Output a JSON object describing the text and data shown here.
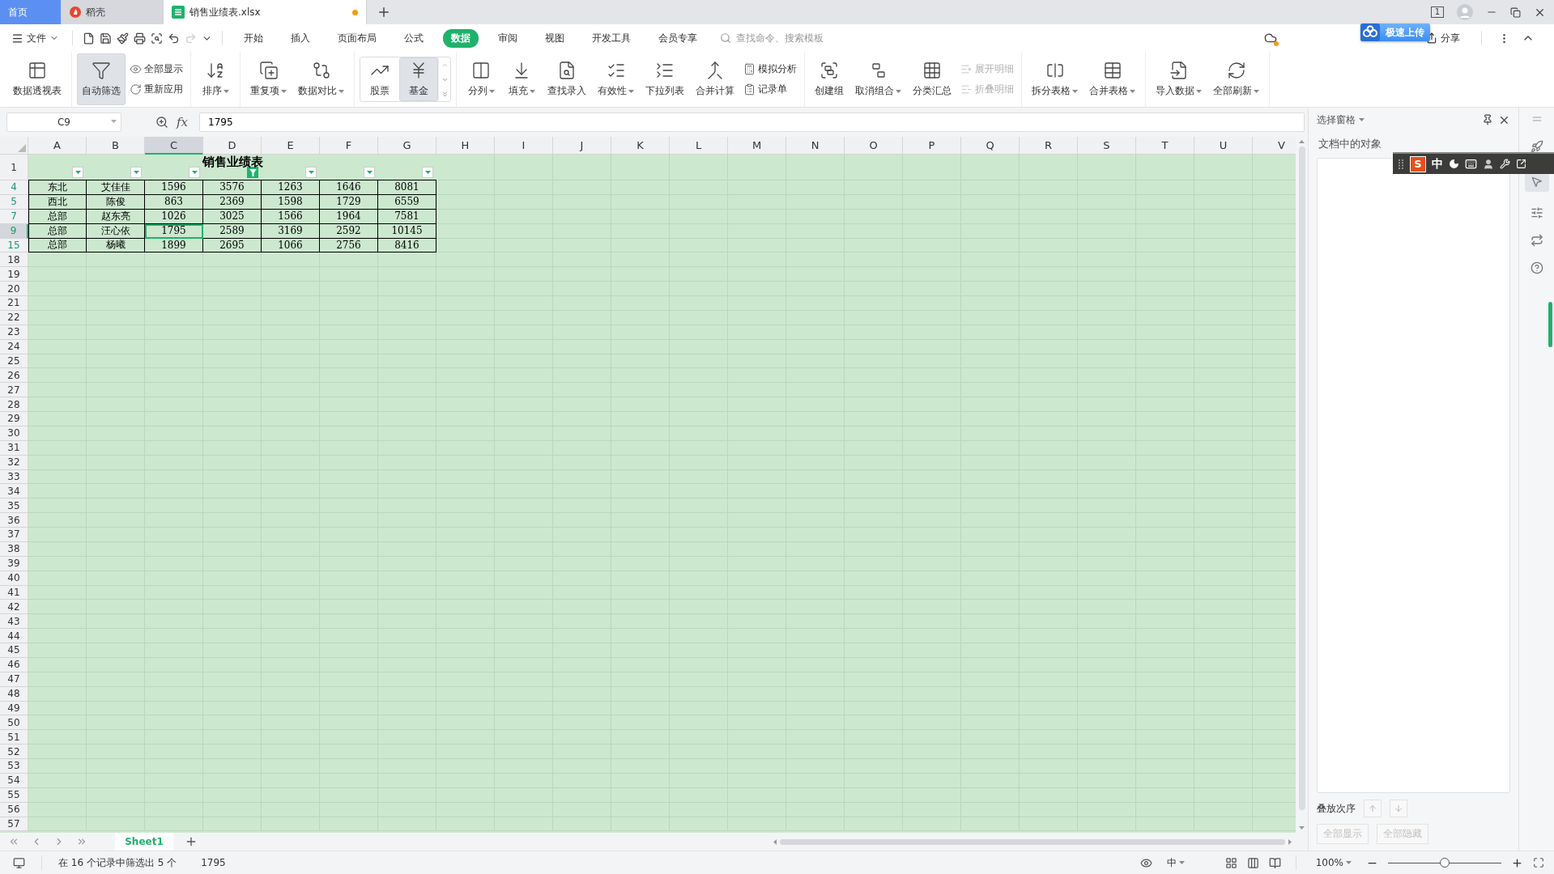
{
  "tabs": [
    {
      "label": "首页",
      "kind": "home",
      "selected": false
    },
    {
      "label": "稻壳",
      "kind": "docer",
      "selected": false
    },
    {
      "label": "销售业绩表.xlsx",
      "kind": "sheet",
      "selected": true,
      "unsaved": true
    }
  ],
  "window": {
    "badge": "1"
  },
  "upload_popup": {
    "label": "极速上传"
  },
  "menu": {
    "file": "文件",
    "tabs": [
      {
        "label": "开始",
        "selected": false
      },
      {
        "label": "插入",
        "selected": false
      },
      {
        "label": "页面布局",
        "selected": false
      },
      {
        "label": "公式",
        "selected": false
      },
      {
        "label": "数据",
        "selected": true
      },
      {
        "label": "审阅",
        "selected": false
      },
      {
        "label": "视图",
        "selected": false
      },
      {
        "label": "开发工具",
        "selected": false
      },
      {
        "label": "会员专享",
        "selected": false
      }
    ],
    "search": {
      "placeholder": "查找命令、搜索模板"
    },
    "share": "分享"
  },
  "ribbon": {
    "groups": [
      {
        "kind": "buttons",
        "items": [
          {
            "kind": "large",
            "label": "数据透视表",
            "dropdown": false,
            "selected": false,
            "disabled": false
          }
        ]
      },
      {
        "kind": "buttons",
        "items": [
          {
            "kind": "large",
            "label": "自动筛选",
            "dropdown": false,
            "selected": true,
            "disabled": false
          },
          {
            "kind": "small",
            "label": "全部显示",
            "dropdown": false,
            "selected": false,
            "disabled": false
          },
          {
            "kind": "small",
            "label": "重新应用",
            "dropdown": false,
            "selected": false,
            "disabled": false
          }
        ]
      },
      {
        "kind": "buttons",
        "items": [
          {
            "kind": "large",
            "label": "排序",
            "dropdown": true,
            "selected": false,
            "disabled": false
          }
        ]
      },
      {
        "kind": "buttons",
        "items": [
          {
            "kind": "large",
            "label": "重复项",
            "dropdown": true,
            "selected": false,
            "disabled": false
          },
          {
            "kind": "large",
            "label": "数据对比",
            "dropdown": true,
            "selected": false,
            "disabled": false
          }
        ]
      },
      {
        "kind": "gallery",
        "items": [
          {
            "kind": "large",
            "label": "股票",
            "dropdown": false,
            "selected": false,
            "disabled": false
          },
          {
            "kind": "large",
            "label": "基金",
            "dropdown": false,
            "selected": true,
            "disabled": false
          }
        ]
      },
      {
        "kind": "buttons",
        "items": [
          {
            "kind": "large",
            "label": "分列",
            "dropdown": true,
            "selected": false,
            "disabled": false
          },
          {
            "kind": "large",
            "label": "填充",
            "dropdown": true,
            "selected": false,
            "disabled": false
          },
          {
            "kind": "large",
            "label": "查找录入",
            "dropdown": false,
            "selected": false,
            "disabled": false
          },
          {
            "kind": "large",
            "label": "有效性",
            "dropdown": true,
            "selected": false,
            "disabled": false
          },
          {
            "kind": "large",
            "label": "下拉列表",
            "dropdown": false,
            "selected": false,
            "disabled": false
          },
          {
            "kind": "large",
            "label": "合并计算",
            "dropdown": false,
            "selected": false,
            "disabled": false
          },
          {
            "kind": "small",
            "label": "模拟分析",
            "dropdown": false,
            "selected": false,
            "disabled": false
          },
          {
            "kind": "small",
            "label": "记录单",
            "dropdown": false,
            "selected": false,
            "disabled": false
          }
        ]
      },
      {
        "kind": "buttons",
        "items": [
          {
            "kind": "large",
            "label": "创建组",
            "dropdown": false,
            "selected": false,
            "disabled": false
          },
          {
            "kind": "large",
            "label": "取消组合",
            "dropdown": true,
            "selected": false,
            "disabled": false
          },
          {
            "kind": "large",
            "label": "分类汇总",
            "dropdown": false,
            "selected": false,
            "disabled": false
          },
          {
            "kind": "small",
            "label": "展开明细",
            "dropdown": false,
            "selected": false,
            "disabled": true
          },
          {
            "kind": "small",
            "label": "折叠明细",
            "dropdown": false,
            "selected": false,
            "disabled": true
          }
        ]
      },
      {
        "kind": "buttons",
        "items": [
          {
            "kind": "large",
            "label": "拆分表格",
            "dropdown": true,
            "selected": false,
            "disabled": false
          },
          {
            "kind": "large",
            "label": "合并表格",
            "dropdown": true,
            "selected": false,
            "disabled": false
          }
        ]
      },
      {
        "kind": "buttons",
        "items": [
          {
            "kind": "large",
            "label": "导入数据",
            "dropdown": true,
            "selected": false,
            "disabled": false
          },
          {
            "kind": "large",
            "label": "全部刷新",
            "dropdown": true,
            "selected": false,
            "disabled": false
          }
        ]
      }
    ]
  },
  "formula_bar": {
    "name_box": "C9",
    "fx_label": "fx",
    "formula": "1795"
  },
  "sheet": {
    "columns": [
      {
        "label": "A",
        "selected": false
      },
      {
        "label": "B",
        "selected": false
      },
      {
        "label": "C",
        "selected": true
      },
      {
        "label": "D",
        "selected": false
      },
      {
        "label": "E",
        "selected": false
      },
      {
        "label": "F",
        "selected": false
      },
      {
        "label": "G",
        "selected": false
      },
      {
        "label": "H",
        "selected": false
      },
      {
        "label": "I",
        "selected": false
      },
      {
        "label": "J",
        "selected": false
      },
      {
        "label": "K",
        "selected": false
      },
      {
        "label": "L",
        "selected": false
      },
      {
        "label": "M",
        "selected": false
      },
      {
        "label": "N",
        "selected": false
      },
      {
        "label": "O",
        "selected": false
      },
      {
        "label": "P",
        "selected": false
      },
      {
        "label": "Q",
        "selected": false
      },
      {
        "label": "R",
        "selected": false
      },
      {
        "label": "S",
        "selected": false
      },
      {
        "label": "T",
        "selected": false
      },
      {
        "label": "U",
        "selected": false
      },
      {
        "label": "V",
        "selected": false
      }
    ],
    "title_row": {
      "label": "1",
      "title": "销售业绩表",
      "filters": [
        {
          "active": false
        },
        {
          "active": false
        },
        {
          "active": false
        },
        {
          "active": true
        },
        {
          "active": false
        },
        {
          "active": false
        },
        {
          "active": false
        }
      ]
    },
    "rows": [
      {
        "label": "4",
        "filtered": true,
        "selected": false,
        "cells": [
          {
            "text": "东北",
            "selected": false
          },
          {
            "text": "艾佳佳",
            "selected": false
          },
          {
            "text": "1596",
            "selected": false
          },
          {
            "text": "3576",
            "selected": false
          },
          {
            "text": "1263",
            "selected": false
          },
          {
            "text": "1646",
            "selected": false
          },
          {
            "text": "8081",
            "selected": false
          }
        ]
      },
      {
        "label": "5",
        "filtered": true,
        "selected": false,
        "cells": [
          {
            "text": "西北",
            "selected": false
          },
          {
            "text": "陈俊",
            "selected": false
          },
          {
            "text": "863",
            "selected": false
          },
          {
            "text": "2369",
            "selected": false
          },
          {
            "text": "1598",
            "selected": false
          },
          {
            "text": "1729",
            "selected": false
          },
          {
            "text": "6559",
            "selected": false
          }
        ]
      },
      {
        "label": "7",
        "filtered": true,
        "selected": false,
        "cells": [
          {
            "text": "总部",
            "selected": false
          },
          {
            "text": "赵东亮",
            "selected": false
          },
          {
            "text": "1026",
            "selected": false
          },
          {
            "text": "3025",
            "selected": false
          },
          {
            "text": "1566",
            "selected": false
          },
          {
            "text": "1964",
            "selected": false
          },
          {
            "text": "7581",
            "selected": false
          }
        ]
      },
      {
        "label": "9",
        "filtered": true,
        "selected": true,
        "cells": [
          {
            "text": "总部",
            "selected": false
          },
          {
            "text": "汪心依",
            "selected": false
          },
          {
            "text": "1795",
            "selected": true
          },
          {
            "text": "2589",
            "selected": false
          },
          {
            "text": "3169",
            "selected": false
          },
          {
            "text": "2592",
            "selected": false
          },
          {
            "text": "10145",
            "selected": false
          }
        ]
      },
      {
        "label": "15",
        "filtered": true,
        "selected": false,
        "cells": [
          {
            "text": "总部",
            "selected": false
          },
          {
            "text": "杨曦",
            "selected": false
          },
          {
            "text": "1899",
            "selected": false
          },
          {
            "text": "2695",
            "selected": false
          },
          {
            "text": "1066",
            "selected": false
          },
          {
            "text": "2756",
            "selected": false
          },
          {
            "text": "8416",
            "selected": false
          }
        ]
      }
    ],
    "empty_rows": [
      "18",
      "19",
      "20",
      "21",
      "22",
      "23",
      "24",
      "25",
      "26",
      "27",
      "28",
      "29",
      "30",
      "31",
      "32",
      "33",
      "34",
      "35",
      "36",
      "37",
      "38",
      "39",
      "40",
      "41",
      "42",
      "43",
      "44",
      "45",
      "46",
      "47",
      "48",
      "49",
      "50",
      "51",
      "52",
      "53",
      "54",
      "55",
      "56",
      "57"
    ]
  },
  "sheet_tabs": [
    {
      "label": "Sheet1",
      "selected": true
    }
  ],
  "selection_pane": {
    "title": "选择窗格",
    "subtitle": "文档中的对象",
    "order_label": "叠放次序",
    "buttons": [
      {
        "label": "全部显示",
        "disabled": true
      },
      {
        "label": "全部隐藏",
        "disabled": true
      }
    ]
  },
  "ime_bar": {
    "logo": "S",
    "mode": "中"
  },
  "status_bar": {
    "message": "在 16 个记录中筛选出 5 个",
    "value": "1795",
    "input_mode": "中",
    "zoom": "100%",
    "zoom_slider": {
      "level": 0.5
    }
  }
}
